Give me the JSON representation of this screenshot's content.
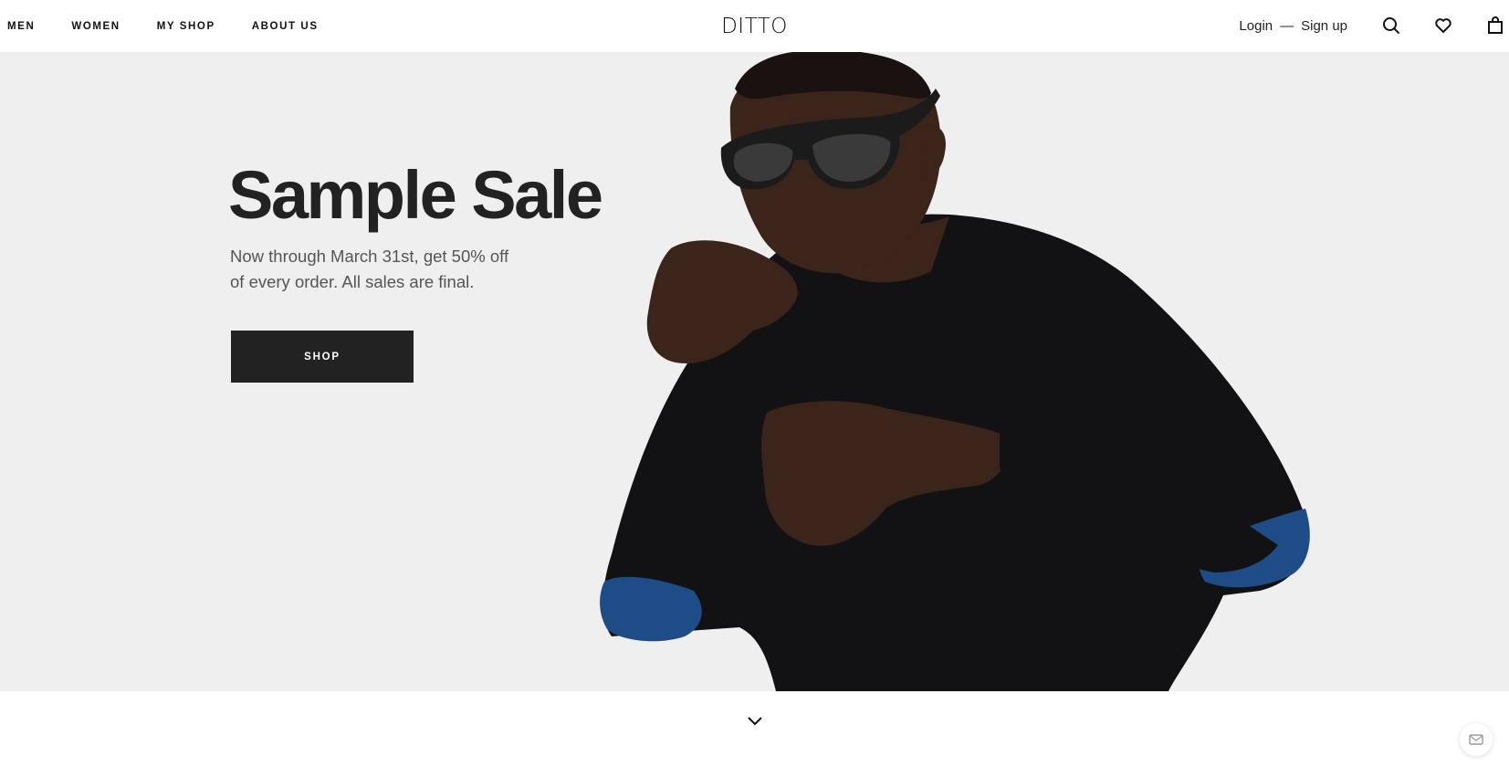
{
  "nav": {
    "items": [
      {
        "label": "MEN"
      },
      {
        "label": "WOMEN"
      },
      {
        "label": "MY SHOP"
      },
      {
        "label": "ABOUT US"
      }
    ]
  },
  "brand": {
    "logo_text": "DITTO"
  },
  "auth": {
    "login": "Login",
    "separator": "—",
    "signup": "Sign up"
  },
  "icons": {
    "search": "search-icon",
    "wishlist": "heart-icon",
    "bag": "shopping-bag-icon",
    "scroll": "chevron-down-icon",
    "chat": "chat-icon"
  },
  "hero": {
    "title": "Sample Sale",
    "subtitle": "Now through March 31st, get 50% off of every order. All sales are final.",
    "cta_label": "SHOP"
  },
  "colors": {
    "hero_background": "#efefef",
    "button": "#222222",
    "text_dark": "#222222",
    "text_muted": "#555555",
    "sweater": "#121215",
    "elbow_patch": "#1e4c86"
  }
}
